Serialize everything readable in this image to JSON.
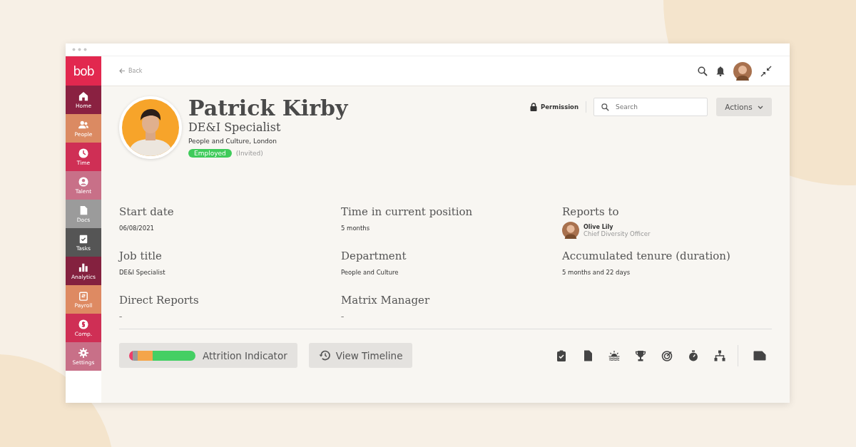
{
  "sidebar": {
    "logo": "bob",
    "items": [
      {
        "label": "Home",
        "color": "#8a2141"
      },
      {
        "label": "People",
        "color": "#db8a62"
      },
      {
        "label": "Time",
        "color": "#cf2f55"
      },
      {
        "label": "Talent",
        "color": "#c87088"
      },
      {
        "label": "Docs",
        "color": "#9b9b9b"
      },
      {
        "label": "Tasks",
        "color": "#555555"
      },
      {
        "label": "Analytics",
        "color": "#84213f"
      },
      {
        "label": "Payroll",
        "color": "#de8a62"
      },
      {
        "label": "Comp.",
        "color": "#cf2f55"
      },
      {
        "label": "Settings",
        "color": "#c87088"
      }
    ]
  },
  "top_bar": {
    "back": "Back"
  },
  "profile": {
    "name": "Patrick Kirby",
    "title": "DE&I Specialist",
    "location": "People and Culture, London",
    "status": "Employed",
    "status_note": "(Invited)"
  },
  "toolbar": {
    "permission": "Permission",
    "search": {
      "placeholder": "Search"
    },
    "actions": "Actions"
  },
  "fields": [
    {
      "label": "Start date",
      "value": "06/08/2021"
    },
    {
      "label": "Time in current position",
      "value": "5 months"
    },
    {
      "label": "Reports to",
      "kind": "person",
      "name": "Olive Lily",
      "role": "Chief Diversity Officer"
    },
    {
      "label": "Job title",
      "value": "DE&I Specialist"
    },
    {
      "label": "Department",
      "value": "People and Culture"
    },
    {
      "label": "Accumulated tenure (duration)",
      "value": "5 months and 22 days"
    },
    {
      "label": "Direct Reports",
      "value": "–"
    },
    {
      "label": "Matrix Manager",
      "value": "–"
    }
  ],
  "attrition": {
    "label": "Attrition Indicator",
    "segments": [
      {
        "color": "#ee3d6a",
        "level": 0.05
      },
      {
        "color": "#9a9a9a",
        "level": 0.08
      },
      {
        "color": "#f4a54a",
        "level": 0.23
      },
      {
        "color": "#44cf63",
        "level": 0.64
      }
    ]
  },
  "timeline_button": "View Timeline"
}
